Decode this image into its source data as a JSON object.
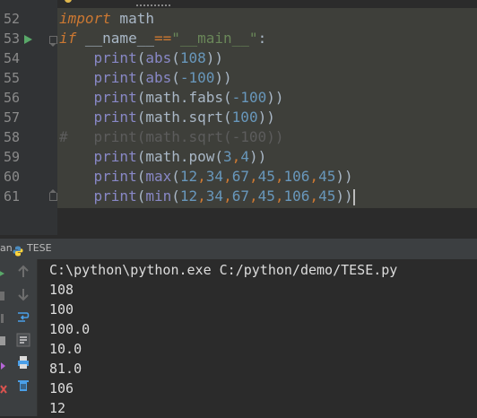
{
  "editor": {
    "line_numbers": [
      "52",
      "53",
      "54",
      "55",
      "56",
      "57",
      "58",
      "59",
      "60",
      "61"
    ],
    "lines": [
      {
        "tokens": [
          {
            "t": "import",
            "c": "kw"
          },
          {
            "t": " math",
            "c": ""
          }
        ]
      },
      {
        "tokens": [
          {
            "t": "if",
            "c": "kw"
          },
          {
            "t": " __name__",
            "c": ""
          },
          {
            "t": "==",
            "c": "op"
          },
          {
            "t": "\"__main__\"",
            "c": "str"
          },
          {
            "t": ":",
            "c": ""
          }
        ]
      },
      {
        "tokens": [
          {
            "t": "    ",
            "c": ""
          },
          {
            "t": "print",
            "c": "fn"
          },
          {
            "t": "(",
            "c": ""
          },
          {
            "t": "abs",
            "c": "fn"
          },
          {
            "t": "(",
            "c": ""
          },
          {
            "t": "108",
            "c": "num"
          },
          {
            "t": "))",
            "c": ""
          }
        ]
      },
      {
        "tokens": [
          {
            "t": "    ",
            "c": ""
          },
          {
            "t": "print",
            "c": "fn"
          },
          {
            "t": "(",
            "c": ""
          },
          {
            "t": "abs",
            "c": "fn"
          },
          {
            "t": "(",
            "c": ""
          },
          {
            "t": "-100",
            "c": "num"
          },
          {
            "t": "))",
            "c": ""
          }
        ]
      },
      {
        "tokens": [
          {
            "t": "    ",
            "c": ""
          },
          {
            "t": "print",
            "c": "fn"
          },
          {
            "t": "(math.fabs(",
            "c": ""
          },
          {
            "t": "-100",
            "c": "num"
          },
          {
            "t": "))",
            "c": ""
          }
        ]
      },
      {
        "tokens": [
          {
            "t": "    ",
            "c": ""
          },
          {
            "t": "print",
            "c": "fn"
          },
          {
            "t": "(math.sqrt(",
            "c": ""
          },
          {
            "t": "100",
            "c": "num"
          },
          {
            "t": "))",
            "c": ""
          }
        ]
      },
      {
        "tokens": [
          {
            "t": "#   print(math.sqrt(-100))",
            "c": "c"
          }
        ],
        "comment": true
      },
      {
        "tokens": [
          {
            "t": "    ",
            "c": ""
          },
          {
            "t": "print",
            "c": "fn"
          },
          {
            "t": "(math.pow(",
            "c": ""
          },
          {
            "t": "3",
            "c": "num"
          },
          {
            "t": ",",
            "c": "op"
          },
          {
            "t": "4",
            "c": "num"
          },
          {
            "t": "))",
            "c": ""
          }
        ]
      },
      {
        "tokens": [
          {
            "t": "    ",
            "c": ""
          },
          {
            "t": "print",
            "c": "fn"
          },
          {
            "t": "(",
            "c": ""
          },
          {
            "t": "max",
            "c": "fn"
          },
          {
            "t": "(",
            "c": ""
          },
          {
            "t": "12",
            "c": "num"
          },
          {
            "t": ",",
            "c": "op"
          },
          {
            "t": "34",
            "c": "num"
          },
          {
            "t": ",",
            "c": "op"
          },
          {
            "t": "67",
            "c": "num"
          },
          {
            "t": ",",
            "c": "op"
          },
          {
            "t": "45",
            "c": "num"
          },
          {
            "t": ",",
            "c": "op"
          },
          {
            "t": "106",
            "c": "num"
          },
          {
            "t": ",",
            "c": "op"
          },
          {
            "t": "45",
            "c": "num"
          },
          {
            "t": "))",
            "c": ""
          }
        ]
      },
      {
        "tokens": [
          {
            "t": "    ",
            "c": ""
          },
          {
            "t": "print",
            "c": "fn"
          },
          {
            "t": "(",
            "c": ""
          },
          {
            "t": "min",
            "c": "fn"
          },
          {
            "t": "(",
            "c": ""
          },
          {
            "t": "12",
            "c": "num"
          },
          {
            "t": ",",
            "c": "op"
          },
          {
            "t": "34",
            "c": "num"
          },
          {
            "t": ",",
            "c": "op"
          },
          {
            "t": "67",
            "c": "num"
          },
          {
            "t": ",",
            "c": "op"
          },
          {
            "t": "45",
            "c": "num"
          },
          {
            "t": ",",
            "c": "op"
          },
          {
            "t": "106",
            "c": "num"
          },
          {
            "t": ",",
            "c": "op"
          },
          {
            "t": "45",
            "c": "num"
          },
          {
            "t": "))",
            "c": ""
          }
        ]
      }
    ]
  },
  "run_panel": {
    "tab_prefix": "an",
    "run_config_name": "TESE",
    "command": "C:\\python\\python.exe C:/python/demo/TESE.py",
    "output": [
      "108",
      "100",
      "100.0",
      "10.0",
      "81.0",
      "106",
      "12"
    ]
  },
  "toolbar_icons": [
    "rerun-icon",
    "stop-icon",
    "up-arrow-icon",
    "down-arrow-icon",
    "soft-wrap-icon",
    "pause-icon",
    "scroll-to-end-icon",
    "print-icon",
    "trash-icon"
  ],
  "colors": {
    "keyword": "#cc7832",
    "builtin": "#8888c6",
    "number": "#6897bb",
    "string": "#6a8759",
    "comment": "#5c5c5c",
    "run_arrow": "#59a869"
  }
}
